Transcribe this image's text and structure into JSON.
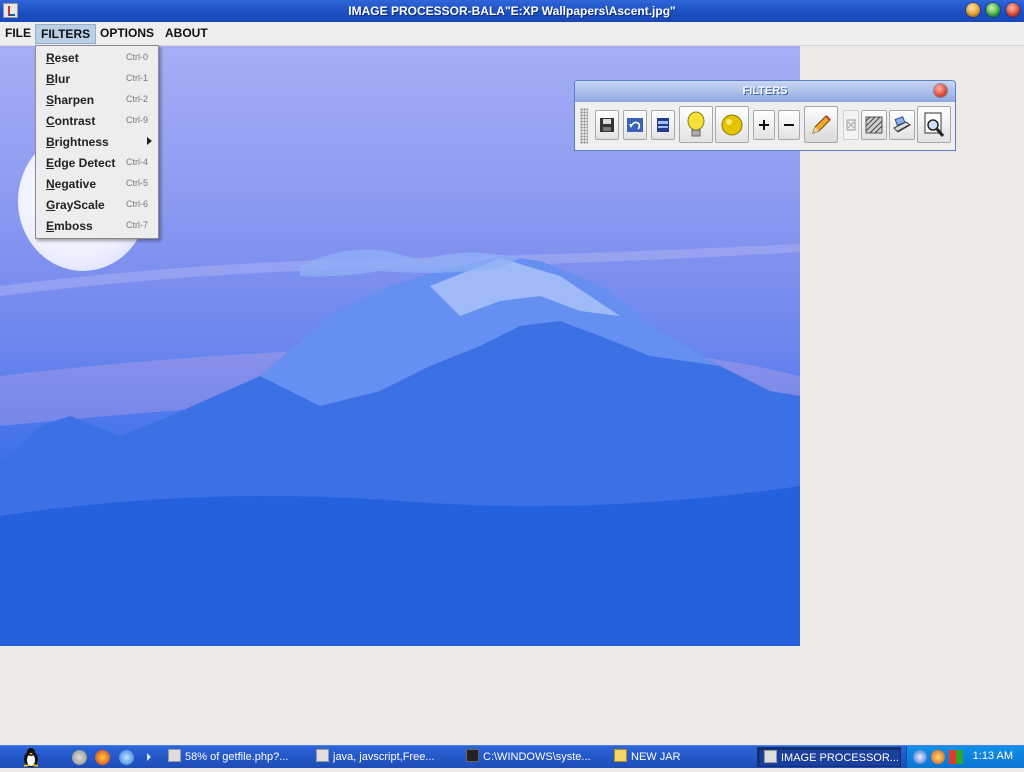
{
  "window": {
    "title": "IMAGE PROCESSOR-BALA\"E:XP Wallpapers\\Ascent.jpg\""
  },
  "menubar": {
    "items": [
      {
        "label": "FILE",
        "active": false
      },
      {
        "label": "FILTERS",
        "active": true
      },
      {
        "label": "OPTIONS",
        "active": false
      },
      {
        "label": "ABOUT",
        "active": false
      }
    ]
  },
  "filters_menu": {
    "items": [
      {
        "label": "Reset",
        "shortcut": "Ctrl-0"
      },
      {
        "label": "Blur",
        "shortcut": "Ctrl-1"
      },
      {
        "label": "Sharpen",
        "shortcut": "Ctrl-2"
      },
      {
        "label": "Contrast",
        "shortcut": "Ctrl-9"
      },
      {
        "label": "Brightness",
        "shortcut": "",
        "submenu": true
      },
      {
        "label": "Edge Detect",
        "shortcut": "Ctrl-4"
      },
      {
        "label": "Negative",
        "shortcut": "Ctrl-5"
      },
      {
        "label": "GrayScale",
        "shortcut": "Ctrl-6"
      },
      {
        "label": "Emboss",
        "shortcut": "Ctrl-7"
      }
    ]
  },
  "filters_toolbar": {
    "title": "FILTERS",
    "tools": [
      "save-icon",
      "undo-icon",
      "screen-icon",
      "bulb-icon",
      "sun-icon",
      "zoom-in-icon",
      "zoom-out-icon",
      "pencil-icon",
      "small-image-icon",
      "hatch-icon",
      "scanner-icon",
      "magnify-icon"
    ]
  },
  "taskbar": {
    "tasks": [
      {
        "label": "58% of getfile.php?...",
        "icon": "download-icon"
      },
      {
        "label": "java, javscript,Free...",
        "icon": "browser-icon"
      },
      {
        "label": "C:\\WINDOWS\\syste...",
        "icon": "console-icon"
      },
      {
        "label": "NEW JAR",
        "icon": "folder-icon"
      },
      {
        "label": "IMAGE PROCESSOR...",
        "icon": "java-icon",
        "active": true
      }
    ],
    "clock": "1:13 AM"
  },
  "colors": {
    "titlebar": "#1D4FC3",
    "menu_active": "#B8CFE5",
    "taskbar": "#2457C8",
    "tray": "#0C74D3"
  }
}
